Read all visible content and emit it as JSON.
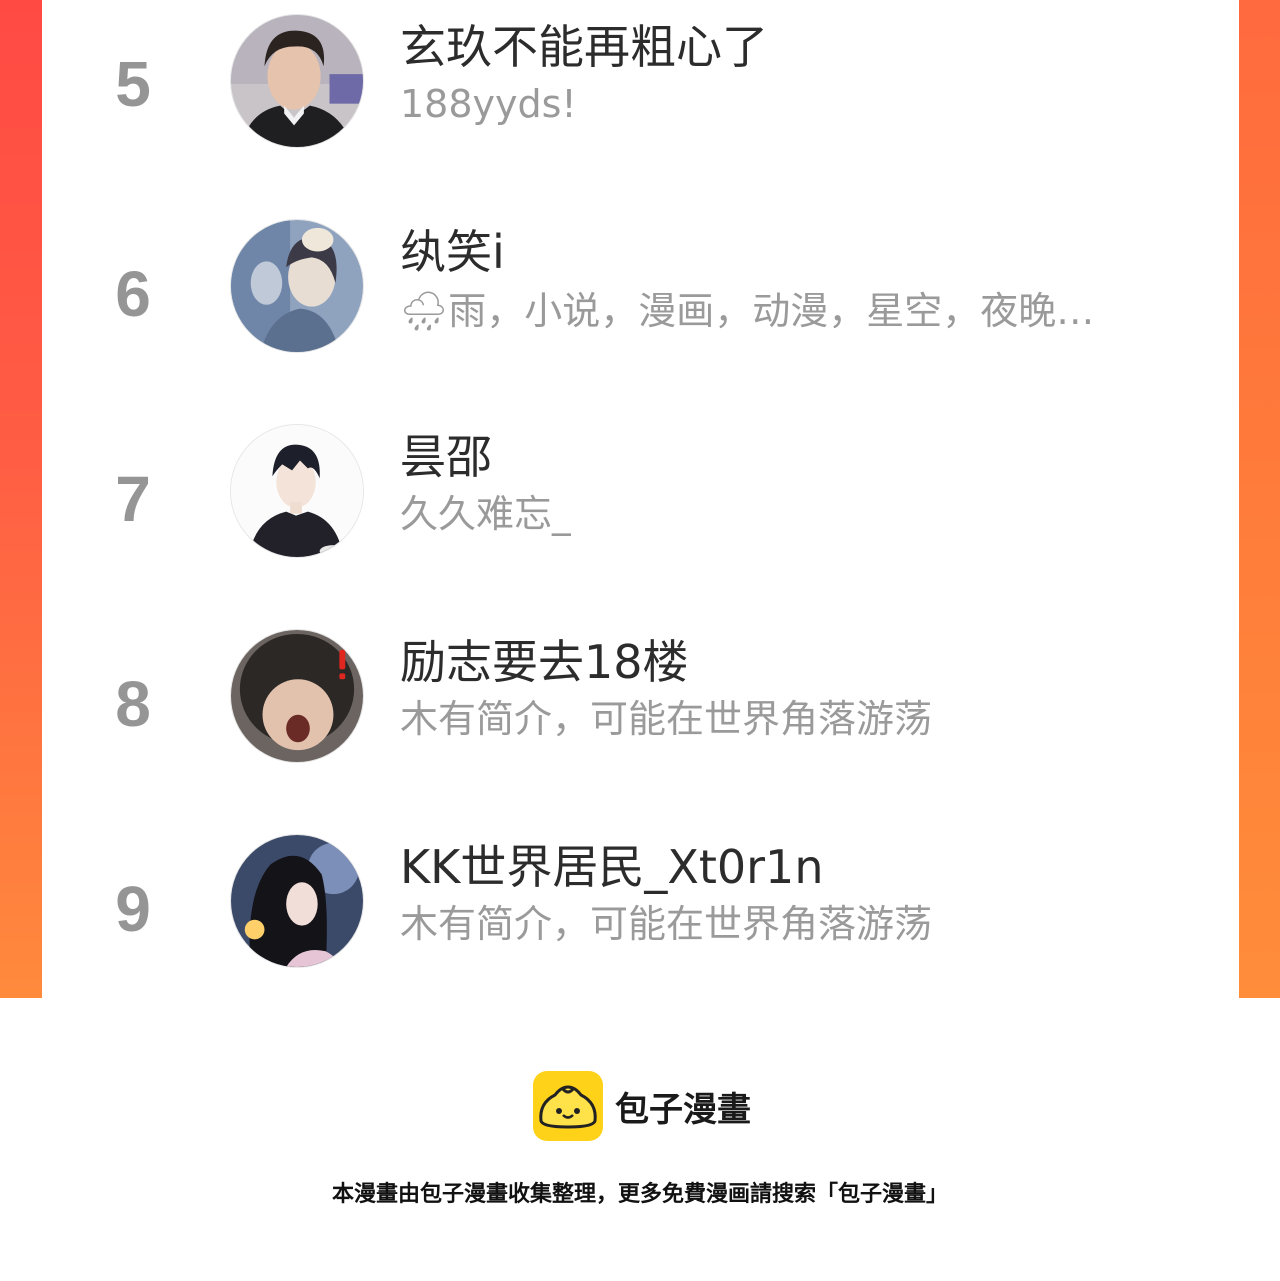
{
  "colors": {
    "frame_red": "#ff4a44",
    "frame_orange": "#ff8a3c",
    "rank_gray": "#959595",
    "name_text": "#2c2c2c",
    "bio_text": "#9a9a9a",
    "logo_yellow": "#ffd21a"
  },
  "ranking": [
    {
      "rank": "5",
      "name": "玄玖不能再粗心了",
      "bio": "188yyds!",
      "avatar_icon": "avatar-photo-man"
    },
    {
      "rank": "6",
      "name": "纨笑i",
      "bio": "🌧雨，小说，漫画，动漫，星空，夜晚…",
      "avatar_icon": "avatar-illustration-blue"
    },
    {
      "rank": "7",
      "name": "昙邵",
      "bio": "久久难忘_",
      "avatar_icon": "avatar-anime-boy"
    },
    {
      "rank": "8",
      "name": "励志要去18楼",
      "bio": "木有简介，可能在世界角落游荡",
      "avatar_icon": "avatar-blurry-face"
    },
    {
      "rank": "9",
      "name": "KK世界居民_Xt0r1n",
      "bio": "木有简介，可能在世界角落游荡",
      "avatar_icon": "avatar-girl-night"
    }
  ],
  "footer": {
    "brand": "包子漫畫",
    "logo_icon": "bun-logo-icon",
    "notice": "本漫畫由包子漫畫收集整理，更多免費漫画請搜索「包子漫畫」"
  }
}
